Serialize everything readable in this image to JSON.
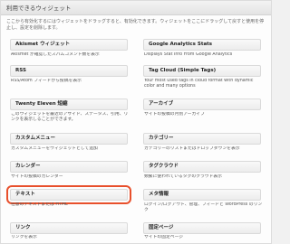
{
  "panel": {
    "title": "利用できるウィジェット",
    "description": "ここから有効化するにはウィジェットをドラッグすると、有効化できます。ウィジェットをここにドラッグして戻すと使用を停止し、設定を削除します。"
  },
  "widgets": [
    {
      "title": "Akismet ウィジェット",
      "desc": "Akismet が確認したスパムコメント数を表示"
    },
    {
      "title": "Google Analytics Stats",
      "desc": "Displays Stat Info From Google Analytics"
    },
    {
      "title": "RSS",
      "desc": "RSS/Atom フィードから投稿を表示"
    },
    {
      "title": "Tag Cloud (Simple Tags)",
      "desc": "Your most used tags in cloud format with dynamic color and many options"
    },
    {
      "title": "Twenty Eleven 短縮",
      "desc": "このウィジェットを最近のアサイド、ステータス、引用、リンクを表示しることができます。"
    },
    {
      "title": "アーカイブ",
      "desc": "サイトの投稿の月別アーカイブ"
    },
    {
      "title": "カスタムメニュー",
      "desc": "カスタムメニューをウィジェットとして追加"
    },
    {
      "title": "カテゴリー",
      "desc": "カテゴリーのリストまたはドロップダウンを表示"
    },
    {
      "title": "カレンダー",
      "desc": "サイトの投稿のカレンダー"
    },
    {
      "title": "タグクラウド",
      "desc": "頻繁に使われているタグのクラウド表示"
    },
    {
      "title": "テキスト",
      "desc": "任意のテキストまたは HTML"
    },
    {
      "title": "メタ情報",
      "desc": "ログイン/ログアウト、管理、フィードと WordPress のリンク"
    },
    {
      "title": "リンク",
      "desc": "リンクを表示"
    },
    {
      "title": "固定ページ",
      "desc": "サイトの固定ページ"
    }
  ]
}
